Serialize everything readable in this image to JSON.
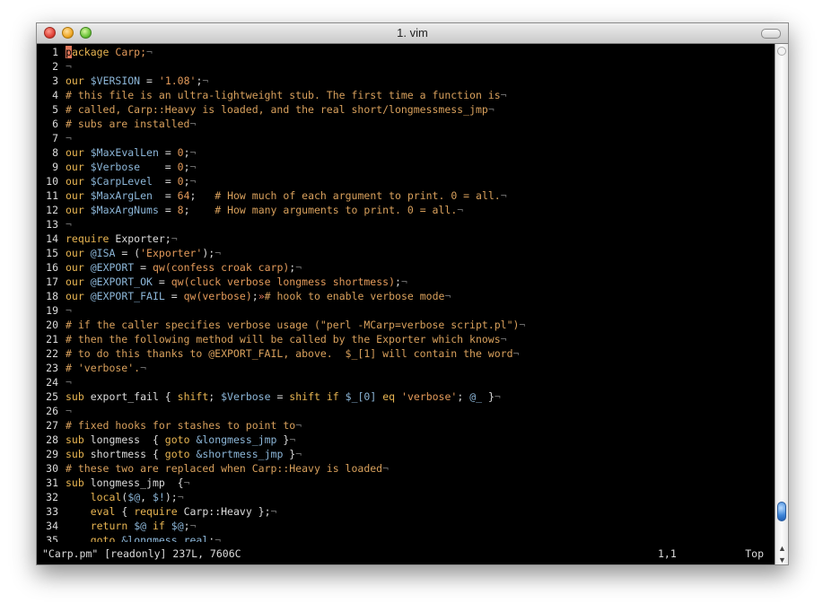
{
  "window": {
    "title": "1. vim"
  },
  "colors": {
    "background": "#000000",
    "default": "#dcdcdc",
    "keyword": "#e8b552",
    "variable": "#8cb6d8",
    "string": "#e39a5a",
    "comment": "#d8a05c",
    "marker": "#6a6a6a",
    "cursor": "#e0775a"
  },
  "editor": {
    "lines": [
      {
        "num": "1",
        "tokens": [
          {
            "t": "p",
            "c": "cursor"
          },
          {
            "t": "ackage",
            "c": "keyword"
          },
          {
            "t": " Carp;",
            "c": "string"
          },
          {
            "t": "¬",
            "c": "marker"
          }
        ]
      },
      {
        "num": "2",
        "tokens": [
          {
            "t": "¬",
            "c": "marker"
          }
        ]
      },
      {
        "num": "3",
        "tokens": [
          {
            "t": "our",
            "c": "keyword"
          },
          {
            "t": " ",
            "c": "default"
          },
          {
            "t": "$VERSION",
            "c": "variable"
          },
          {
            "t": " = ",
            "c": "default"
          },
          {
            "t": "'1.08'",
            "c": "string"
          },
          {
            "t": ";",
            "c": "default"
          },
          {
            "t": "¬",
            "c": "marker"
          }
        ]
      },
      {
        "num": "4",
        "tokens": [
          {
            "t": "# this file is an ultra-lightweight stub. The first time a function is",
            "c": "comment"
          },
          {
            "t": "¬",
            "c": "marker"
          }
        ]
      },
      {
        "num": "5",
        "tokens": [
          {
            "t": "# called, Carp::Heavy is loaded, and the real short/longmessmess_jmp",
            "c": "comment"
          },
          {
            "t": "¬",
            "c": "marker"
          }
        ]
      },
      {
        "num": "6",
        "tokens": [
          {
            "t": "# subs are installed",
            "c": "comment"
          },
          {
            "t": "¬",
            "c": "marker"
          }
        ]
      },
      {
        "num": "7",
        "tokens": [
          {
            "t": "¬",
            "c": "marker"
          }
        ]
      },
      {
        "num": "8",
        "tokens": [
          {
            "t": "our",
            "c": "keyword"
          },
          {
            "t": " ",
            "c": "default"
          },
          {
            "t": "$MaxEvalLen",
            "c": "variable"
          },
          {
            "t": " = ",
            "c": "default"
          },
          {
            "t": "0",
            "c": "string"
          },
          {
            "t": ";",
            "c": "default"
          },
          {
            "t": "¬",
            "c": "marker"
          }
        ]
      },
      {
        "num": "9",
        "tokens": [
          {
            "t": "our",
            "c": "keyword"
          },
          {
            "t": " ",
            "c": "default"
          },
          {
            "t": "$Verbose",
            "c": "variable"
          },
          {
            "t": "    = ",
            "c": "default"
          },
          {
            "t": "0",
            "c": "string"
          },
          {
            "t": ";",
            "c": "default"
          },
          {
            "t": "¬",
            "c": "marker"
          }
        ]
      },
      {
        "num": "10",
        "tokens": [
          {
            "t": "our",
            "c": "keyword"
          },
          {
            "t": " ",
            "c": "default"
          },
          {
            "t": "$CarpLevel",
            "c": "variable"
          },
          {
            "t": "  = ",
            "c": "default"
          },
          {
            "t": "0",
            "c": "string"
          },
          {
            "t": ";",
            "c": "default"
          },
          {
            "t": "¬",
            "c": "marker"
          }
        ]
      },
      {
        "num": "11",
        "tokens": [
          {
            "t": "our",
            "c": "keyword"
          },
          {
            "t": " ",
            "c": "default"
          },
          {
            "t": "$MaxArgLen",
            "c": "variable"
          },
          {
            "t": "  = ",
            "c": "default"
          },
          {
            "t": "64",
            "c": "string"
          },
          {
            "t": ";   ",
            "c": "default"
          },
          {
            "t": "# How much of each argument to print. 0 = all.",
            "c": "comment"
          },
          {
            "t": "¬",
            "c": "marker"
          }
        ]
      },
      {
        "num": "12",
        "tokens": [
          {
            "t": "our",
            "c": "keyword"
          },
          {
            "t": " ",
            "c": "default"
          },
          {
            "t": "$MaxArgNums",
            "c": "variable"
          },
          {
            "t": " = ",
            "c": "default"
          },
          {
            "t": "8",
            "c": "string"
          },
          {
            "t": ";    ",
            "c": "default"
          },
          {
            "t": "# How many arguments to print. 0 = all.",
            "c": "comment"
          },
          {
            "t": "¬",
            "c": "marker"
          }
        ]
      },
      {
        "num": "13",
        "tokens": [
          {
            "t": "¬",
            "c": "marker"
          }
        ]
      },
      {
        "num": "14",
        "tokens": [
          {
            "t": "require",
            "c": "keyword"
          },
          {
            "t": " Exporter;",
            "c": "default"
          },
          {
            "t": "¬",
            "c": "marker"
          }
        ]
      },
      {
        "num": "15",
        "tokens": [
          {
            "t": "our",
            "c": "keyword"
          },
          {
            "t": " ",
            "c": "default"
          },
          {
            "t": "@ISA",
            "c": "variable"
          },
          {
            "t": " = (",
            "c": "default"
          },
          {
            "t": "'Exporter'",
            "c": "string"
          },
          {
            "t": ");",
            "c": "default"
          },
          {
            "t": "¬",
            "c": "marker"
          }
        ]
      },
      {
        "num": "16",
        "tokens": [
          {
            "t": "our",
            "c": "keyword"
          },
          {
            "t": " ",
            "c": "default"
          },
          {
            "t": "@EXPORT",
            "c": "variable"
          },
          {
            "t": " = ",
            "c": "default"
          },
          {
            "t": "qw(confess croak carp)",
            "c": "string"
          },
          {
            "t": ";",
            "c": "default"
          },
          {
            "t": "¬",
            "c": "marker"
          }
        ]
      },
      {
        "num": "17",
        "tokens": [
          {
            "t": "our",
            "c": "keyword"
          },
          {
            "t": " ",
            "c": "default"
          },
          {
            "t": "@EXPORT_OK",
            "c": "variable"
          },
          {
            "t": " = ",
            "c": "default"
          },
          {
            "t": "qw(cluck verbose longmess shortmess)",
            "c": "string"
          },
          {
            "t": ";",
            "c": "default"
          },
          {
            "t": "¬",
            "c": "marker"
          }
        ]
      },
      {
        "num": "18",
        "tokens": [
          {
            "t": "our",
            "c": "keyword"
          },
          {
            "t": " ",
            "c": "default"
          },
          {
            "t": "@EXPORT_FAIL",
            "c": "variable"
          },
          {
            "t": " = ",
            "c": "default"
          },
          {
            "t": "qw(verbose)",
            "c": "string"
          },
          {
            "t": ";",
            "c": "default"
          },
          {
            "t": "»",
            "c": "cursor"
          },
          {
            "t": "# hook to enable verbose mode",
            "c": "comment"
          },
          {
            "t": "¬",
            "c": "marker"
          }
        ]
      },
      {
        "num": "19",
        "tokens": [
          {
            "t": "¬",
            "c": "marker"
          }
        ]
      },
      {
        "num": "20",
        "tokens": [
          {
            "t": "# if the caller specifies verbose usage (\"perl -MCarp=verbose script.pl\")",
            "c": "comment"
          },
          {
            "t": "¬",
            "c": "marker"
          }
        ]
      },
      {
        "num": "21",
        "tokens": [
          {
            "t": "# then the following method will be called by the Exporter which knows",
            "c": "comment"
          },
          {
            "t": "¬",
            "c": "marker"
          }
        ]
      },
      {
        "num": "22",
        "tokens": [
          {
            "t": "# to do this thanks to @EXPORT_FAIL, above.  $_[1] will contain the word",
            "c": "comment"
          },
          {
            "t": "¬",
            "c": "marker"
          }
        ]
      },
      {
        "num": "23",
        "tokens": [
          {
            "t": "# 'verbose'.",
            "c": "comment"
          },
          {
            "t": "¬",
            "c": "marker"
          }
        ]
      },
      {
        "num": "24",
        "tokens": [
          {
            "t": "¬",
            "c": "marker"
          }
        ]
      },
      {
        "num": "25",
        "tokens": [
          {
            "t": "sub",
            "c": "keyword"
          },
          {
            "t": " export_fail { ",
            "c": "default"
          },
          {
            "t": "shift",
            "c": "keyword"
          },
          {
            "t": "; ",
            "c": "default"
          },
          {
            "t": "$Verbose",
            "c": "variable"
          },
          {
            "t": " = ",
            "c": "default"
          },
          {
            "t": "shift",
            "c": "keyword"
          },
          {
            "t": " ",
            "c": "default"
          },
          {
            "t": "if",
            "c": "keyword"
          },
          {
            "t": " ",
            "c": "default"
          },
          {
            "t": "$_[0]",
            "c": "variable"
          },
          {
            "t": " ",
            "c": "default"
          },
          {
            "t": "eq",
            "c": "keyword"
          },
          {
            "t": " ",
            "c": "default"
          },
          {
            "t": "'verbose'",
            "c": "string"
          },
          {
            "t": "; ",
            "c": "default"
          },
          {
            "t": "@_",
            "c": "variable"
          },
          {
            "t": " }",
            "c": "default"
          },
          {
            "t": "¬",
            "c": "marker"
          }
        ]
      },
      {
        "num": "26",
        "tokens": [
          {
            "t": "¬",
            "c": "marker"
          }
        ]
      },
      {
        "num": "27",
        "tokens": [
          {
            "t": "# fixed hooks for stashes to point to",
            "c": "comment"
          },
          {
            "t": "¬",
            "c": "marker"
          }
        ]
      },
      {
        "num": "28",
        "tokens": [
          {
            "t": "sub",
            "c": "keyword"
          },
          {
            "t": " longmess  { ",
            "c": "default"
          },
          {
            "t": "goto",
            "c": "keyword"
          },
          {
            "t": " ",
            "c": "default"
          },
          {
            "t": "&longmess_jmp",
            "c": "variable"
          },
          {
            "t": " }",
            "c": "default"
          },
          {
            "t": "¬",
            "c": "marker"
          }
        ]
      },
      {
        "num": "29",
        "tokens": [
          {
            "t": "sub",
            "c": "keyword"
          },
          {
            "t": " shortmess { ",
            "c": "default"
          },
          {
            "t": "goto",
            "c": "keyword"
          },
          {
            "t": " ",
            "c": "default"
          },
          {
            "t": "&shortmess_jmp",
            "c": "variable"
          },
          {
            "t": " }",
            "c": "default"
          },
          {
            "t": "¬",
            "c": "marker"
          }
        ]
      },
      {
        "num": "30",
        "tokens": [
          {
            "t": "# these two are replaced when Carp::Heavy is loaded",
            "c": "comment"
          },
          {
            "t": "¬",
            "c": "marker"
          }
        ]
      },
      {
        "num": "31",
        "tokens": [
          {
            "t": "sub",
            "c": "keyword"
          },
          {
            "t": " longmess_jmp  {",
            "c": "default"
          },
          {
            "t": "¬",
            "c": "marker"
          }
        ]
      },
      {
        "num": "32",
        "tokens": [
          {
            "t": "    ",
            "c": "default"
          },
          {
            "t": "local",
            "c": "keyword"
          },
          {
            "t": "(",
            "c": "default"
          },
          {
            "t": "$@",
            "c": "variable"
          },
          {
            "t": ", ",
            "c": "default"
          },
          {
            "t": "$!",
            "c": "variable"
          },
          {
            "t": ");",
            "c": "default"
          },
          {
            "t": "¬",
            "c": "marker"
          }
        ]
      },
      {
        "num": "33",
        "tokens": [
          {
            "t": "    ",
            "c": "default"
          },
          {
            "t": "eval",
            "c": "keyword"
          },
          {
            "t": " { ",
            "c": "default"
          },
          {
            "t": "require",
            "c": "keyword"
          },
          {
            "t": " Carp::Heavy };",
            "c": "default"
          },
          {
            "t": "¬",
            "c": "marker"
          }
        ]
      },
      {
        "num": "34",
        "tokens": [
          {
            "t": "    ",
            "c": "default"
          },
          {
            "t": "return",
            "c": "keyword"
          },
          {
            "t": " ",
            "c": "default"
          },
          {
            "t": "$@",
            "c": "variable"
          },
          {
            "t": " ",
            "c": "default"
          },
          {
            "t": "if",
            "c": "keyword"
          },
          {
            "t": " ",
            "c": "default"
          },
          {
            "t": "$@",
            "c": "variable"
          },
          {
            "t": ";",
            "c": "default"
          },
          {
            "t": "¬",
            "c": "marker"
          }
        ]
      },
      {
        "num": "35",
        "tokens": [
          {
            "t": "    ",
            "c": "default"
          },
          {
            "t": "goto",
            "c": "keyword"
          },
          {
            "t": " ",
            "c": "default"
          },
          {
            "t": "&longmess_real",
            "c": "variable"
          },
          {
            "t": ";",
            "c": "default"
          },
          {
            "t": "¬",
            "c": "marker"
          }
        ]
      }
    ]
  },
  "status": {
    "file": "\"Carp.pm\" [readonly] 237L, 7606C",
    "position": "1,1",
    "scroll": "Top"
  },
  "scrollbar": {
    "position_fraction": 0.0
  }
}
